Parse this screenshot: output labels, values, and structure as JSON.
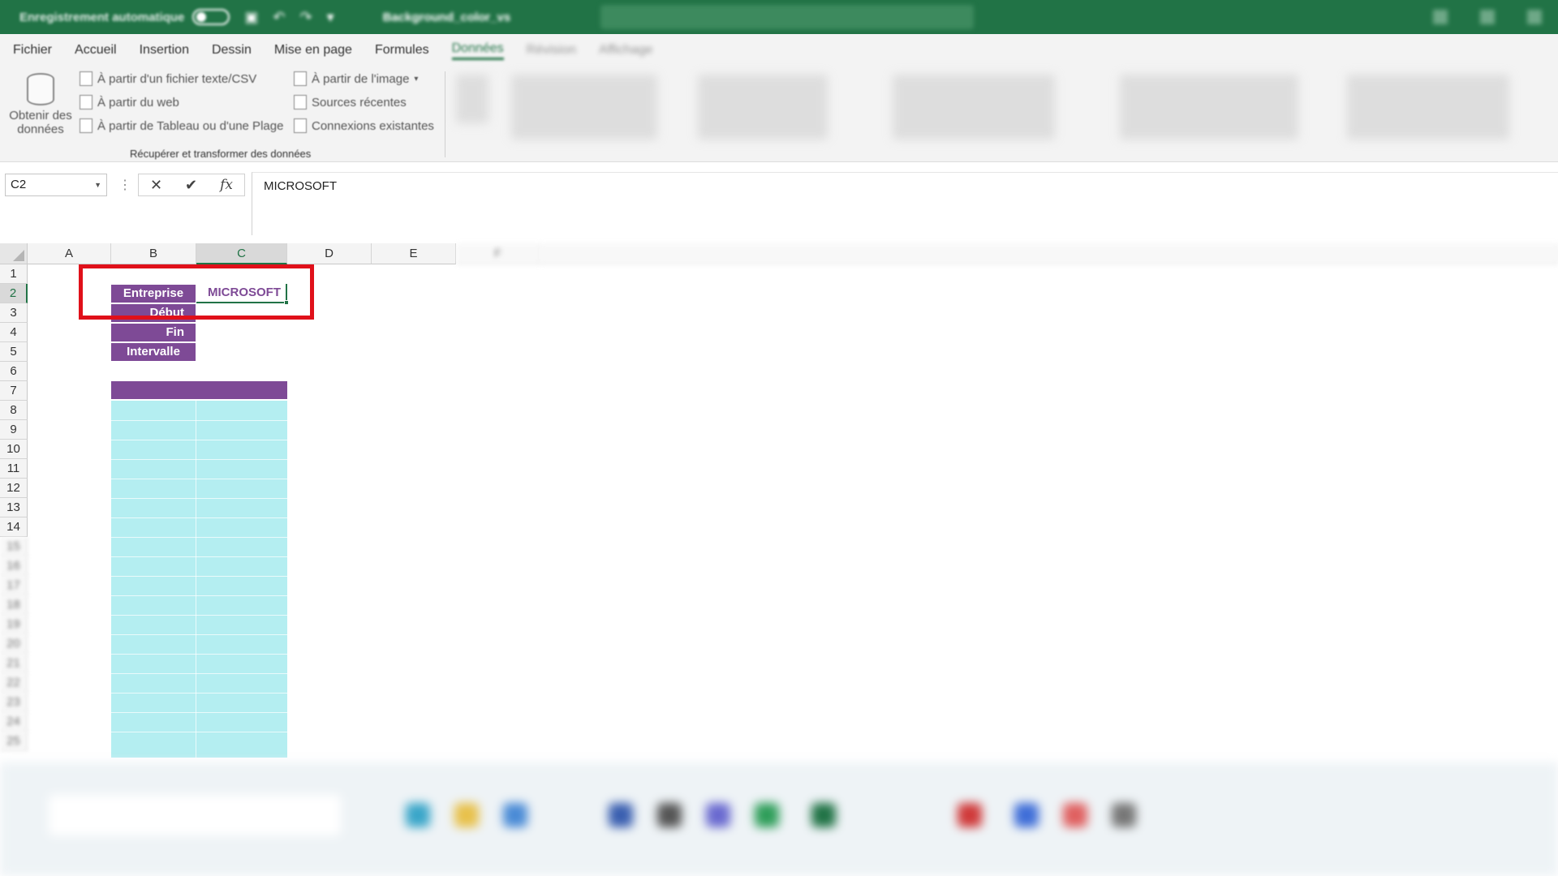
{
  "titlebar": {
    "autosave_label": "Enregistrement automatique",
    "doc_title": "Background_color_vs"
  },
  "menu": {
    "tabs": [
      "Fichier",
      "Accueil",
      "Insertion",
      "Dessin",
      "Mise en page",
      "Formules",
      "Données",
      "Révision",
      "Affichage"
    ]
  },
  "ribbon": {
    "get_data_label_1": "Obtenir des",
    "get_data_label_2": "données",
    "from_text_csv": "À partir d'un fichier texte/CSV",
    "from_web": "À partir du web",
    "from_table": "À partir de Tableau ou d'une Plage",
    "from_image": "À partir de l'image",
    "recent_sources": "Sources récentes",
    "existing_connections": "Connexions existantes",
    "group_label": "Récupérer et transformer des données"
  },
  "formula_bar": {
    "name_box": "C2",
    "cancel_icon": "✕",
    "enter_icon": "✔",
    "fx_label": "fx",
    "content": "MICROSOFT"
  },
  "grid": {
    "columns": [
      "A",
      "B",
      "C",
      "D",
      "E",
      "F"
    ],
    "selected_column": "C",
    "rows": [
      "1",
      "2",
      "3",
      "4",
      "5",
      "6",
      "7",
      "8",
      "9",
      "10",
      "11",
      "12",
      "13",
      "14",
      "15",
      "16",
      "17",
      "18",
      "19",
      "20",
      "21",
      "22",
      "23",
      "24",
      "25"
    ],
    "selected_row": "2",
    "cells": {
      "B2": "Entreprise",
      "C2": "MICROSOFT",
      "B3": "Début",
      "B4": "Fin",
      "B5": "Intervalle"
    }
  },
  "colors": {
    "excel_green": "#217346",
    "purple_header": "#7e4a96",
    "table_fill": "#b4eef1",
    "highlight_red": "#e0101a"
  }
}
